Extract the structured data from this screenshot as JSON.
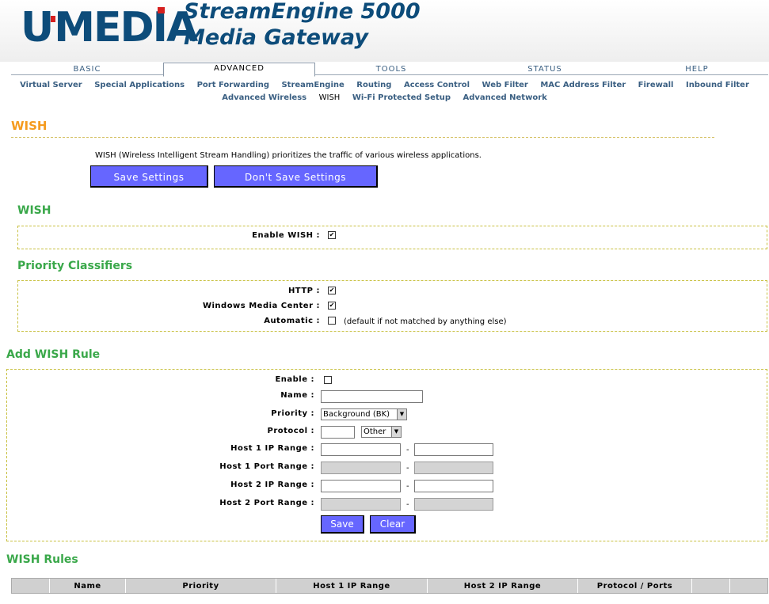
{
  "header": {
    "logo_text": "U-MEDIA",
    "logo_parts": [
      "U",
      "MED",
      "I",
      "A"
    ],
    "product_line1": "StreamEngine 5000",
    "product_line2": "Media Gateway"
  },
  "tabs": [
    {
      "label": "BASIC"
    },
    {
      "label": "ADVANCED"
    },
    {
      "label": "TOOLS"
    },
    {
      "label": "STATUS"
    },
    {
      "label": "HELP"
    }
  ],
  "subnav_row1": [
    "Virtual Server",
    "Special Applications",
    "Port Forwarding",
    "StreamEngine",
    "Routing",
    "Access Control",
    "Web Filter",
    "MAC Address Filter",
    "Firewall",
    "Inbound Filter"
  ],
  "subnav_row2": [
    "Advanced Wireless",
    "WISH",
    "Wi-Fi Protected Setup",
    "Advanced Network"
  ],
  "page": {
    "title": "WISH",
    "intro": "WISH (Wireless Intelligent Stream Handling) prioritizes the traffic of various wireless applications.",
    "save_settings": "Save Settings",
    "dont_save_settings": "Don't Save Settings"
  },
  "wish_section": {
    "title": "WISH",
    "enable_label": "Enable WISH :",
    "enable_checked": true
  },
  "priority_classifiers": {
    "title": "Priority Classifiers",
    "items": [
      {
        "label": "HTTP :",
        "checked": true,
        "note": ""
      },
      {
        "label": "Windows Media Center :",
        "checked": true,
        "note": ""
      },
      {
        "label": "Automatic :",
        "checked": false,
        "note": "(default if not matched by anything else)"
      }
    ]
  },
  "add_rule": {
    "title": "Add WISH Rule",
    "enable_label": "Enable :",
    "enable_checked": false,
    "name_label": "Name :",
    "name_value": "",
    "priority_label": "Priority :",
    "priority_value": "Background (BK)",
    "protocol_label": "Protocol :",
    "protocol_number": "",
    "protocol_value": "Other",
    "host1_ip_label": "Host 1 IP Range :",
    "host1_port_label": "Host 1 Port Range :",
    "host2_ip_label": "Host 2 IP Range :",
    "host2_port_label": "Host 2 Port Range :",
    "range_separator": "-",
    "save_label": "Save",
    "clear_label": "Clear"
  },
  "rules_table": {
    "title": "WISH Rules",
    "columns": [
      "Name",
      "Priority",
      "Host 1 IP Range",
      "Host 2 IP Range",
      "Protocol / Ports"
    ]
  },
  "colors": {
    "brand": "#0d4c7a",
    "logo_accent": "#d6201f",
    "title_orange": "#f59b1f",
    "section_green": "#3aa84a",
    "button_blue": "#6666ff"
  }
}
